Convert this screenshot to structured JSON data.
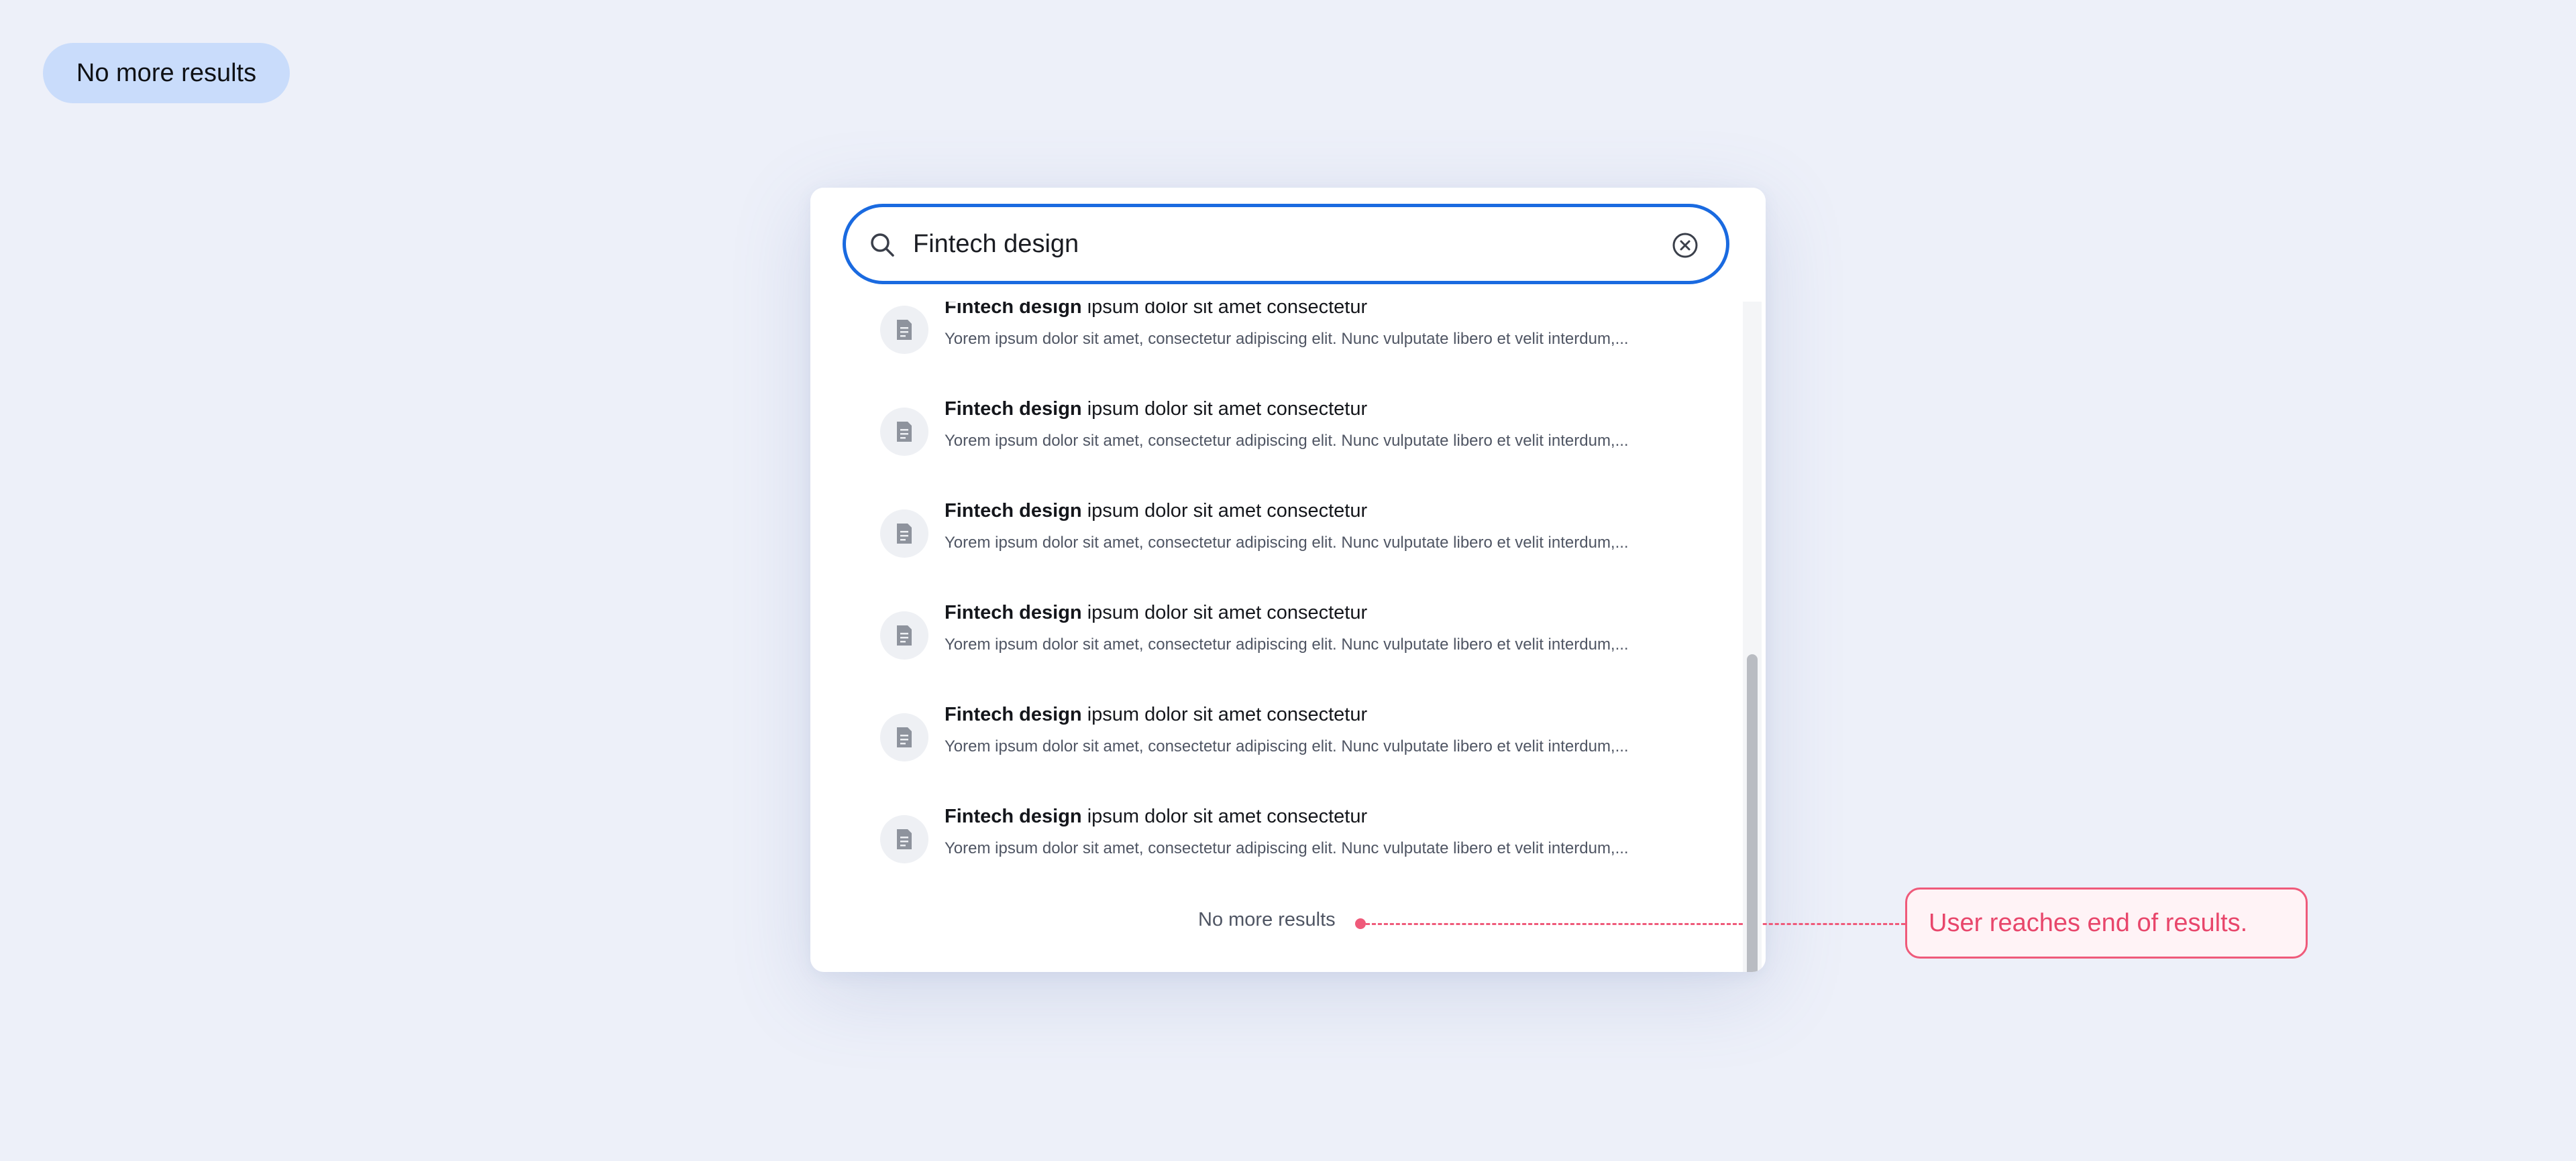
{
  "state_label": "No more results",
  "search": {
    "value": "Fintech design",
    "placeholder": ""
  },
  "results": [
    {
      "title_bold": "Fintech design",
      "title_rest": " ipsum dolor sit amet consectetur",
      "snippet": "Yorem ipsum dolor sit amet, consectetur adipiscing elit. Nunc vulputate libero et velit interdum,..."
    },
    {
      "title_bold": "Fintech design",
      "title_rest": " ipsum dolor sit amet consectetur",
      "snippet": "Yorem ipsum dolor sit amet, consectetur adipiscing elit. Nunc vulputate libero et velit interdum,..."
    },
    {
      "title_bold": "Fintech design",
      "title_rest": " ipsum dolor sit amet consectetur",
      "snippet": "Yorem ipsum dolor sit amet, consectetur adipiscing elit. Nunc vulputate libero et velit interdum,..."
    },
    {
      "title_bold": "Fintech design",
      "title_rest": " ipsum dolor sit amet consectetur",
      "snippet": "Yorem ipsum dolor sit amet, consectetur adipiscing elit. Nunc vulputate libero et velit interdum,..."
    },
    {
      "title_bold": "Fintech design",
      "title_rest": " ipsum dolor sit amet consectetur",
      "snippet": "Yorem ipsum dolor sit amet, consectetur adipiscing elit. Nunc vulputate libero et velit interdum,..."
    },
    {
      "title_bold": "Fintech design",
      "title_rest": " ipsum dolor sit amet consectetur",
      "snippet": "Yorem ipsum dolor sit amet, consectetur adipiscing elit. Nunc vulputate libero et velit interdum,..."
    }
  ],
  "end_of_results_label": "No more results",
  "annotation": {
    "text": "User reaches end of results."
  },
  "icons": {
    "search": "search-icon",
    "clear": "clear-circle-x-icon",
    "result": "document-icon"
  },
  "colors": {
    "background": "#edf0f9",
    "accent": "#1a6ae0",
    "pill": "#c9dcfb",
    "annotation": "#ef5a7a"
  }
}
